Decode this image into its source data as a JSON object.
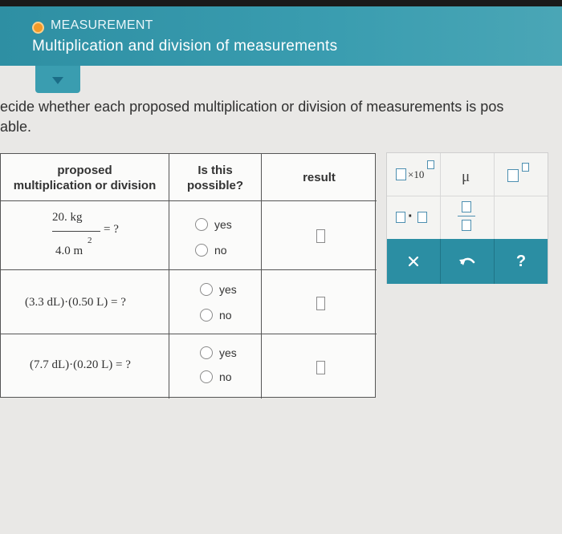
{
  "header": {
    "topic": "MEASUREMENT",
    "subtitle": "Multiplication and division of measurements"
  },
  "instruction": {
    "line1": "ecide whether each proposed multiplication or division of measurements is pos",
    "line2": "able."
  },
  "table": {
    "headers": {
      "col1_line1": "proposed",
      "col1_line2": "multiplication or division",
      "col2_line1": "Is this",
      "col2_line2": "possible?",
      "col3": "result"
    },
    "rows": [
      {
        "numerator": "20. kg",
        "denominator": "4.0 m",
        "denominator_exp": "2",
        "equals": "= ?",
        "option_yes": "yes",
        "option_no": "no"
      },
      {
        "expression": "(3.3 dL)·(0.50 L) = ?",
        "option_yes": "yes",
        "option_no": "no"
      },
      {
        "expression": "(7.7 dL)·(0.20 L) = ?",
        "option_yes": "yes",
        "option_no": "no"
      }
    ]
  },
  "palette": {
    "sci_notation": "×10",
    "mu": "μ",
    "dot": "·",
    "clear_icon": "x-icon",
    "undo_icon": "undo-icon",
    "help": "?"
  },
  "colors": {
    "header_teal": "#3a9db0",
    "topic_dot": "#f39a28",
    "palette_bar": "#2b8ea3"
  }
}
